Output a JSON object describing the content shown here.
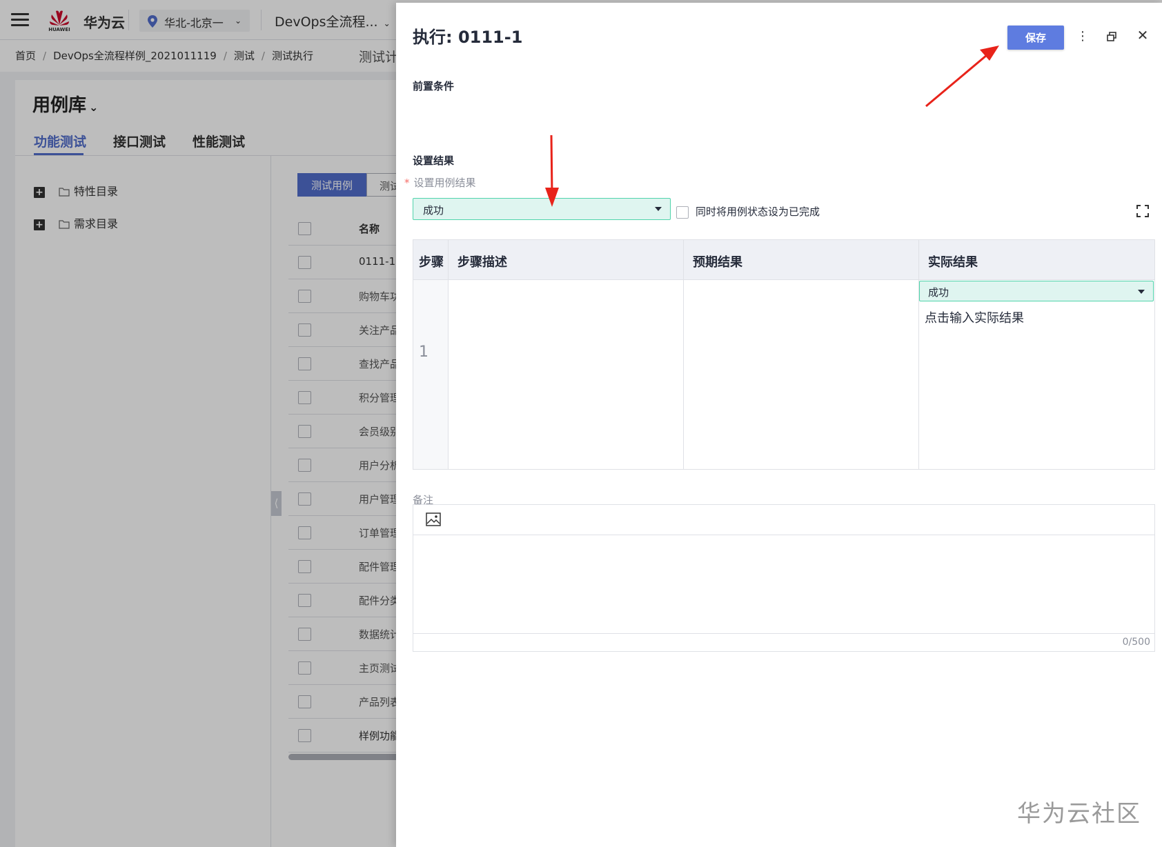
{
  "topbar": {
    "brand": "华为云",
    "logo_text": "HUAWEI",
    "region": "华北-北京一",
    "project": "DevOps全流程..."
  },
  "breadcrumb": {
    "items": [
      "首页",
      "DevOps全流程样例_2021011119",
      "测试",
      "测试执行"
    ],
    "separator": "/",
    "right_text": "测试计"
  },
  "library": {
    "title": "用例库",
    "tabs": [
      {
        "label": "功能测试",
        "active": true
      },
      {
        "label": "接口测试",
        "active": false
      },
      {
        "label": "性能测试",
        "active": false
      }
    ],
    "tree": [
      {
        "label": "特性目录"
      },
      {
        "label": "需求目录"
      }
    ],
    "segments": [
      "测试用例",
      "测试"
    ],
    "table_header": "名称",
    "rows": [
      "0111-1",
      "购物车功",
      "关注产品",
      "查找产品",
      "积分管理",
      "会员级别",
      "用户分析",
      "用户管理",
      "订单管理",
      "配件管理",
      "配件分类",
      "数据统计",
      "主页测试",
      "产品列表",
      "样例功能"
    ]
  },
  "drawer": {
    "title": "执行: 0111-1",
    "save_label": "保存",
    "more_icon": "more-vertical-icon",
    "restore_icon": "window-restore-icon",
    "close_icon": "close-icon",
    "precondition_label": "前置条件",
    "set_result_label": "设置结果",
    "required_label": "设置用例结果",
    "result_value": "成功",
    "mark_complete_label": "同时将用例状态设为已完成",
    "steps": {
      "headers": [
        "步骤",
        "步骤描述",
        "预期结果",
        "实际结果"
      ],
      "rows": [
        {
          "index": "1",
          "description": "",
          "expected": "",
          "actual_status": "成功",
          "actual_placeholder": "点击输入实际结果"
        }
      ]
    },
    "remark_label": "备注",
    "remark_count": "0/500"
  },
  "watermark": "华为云社区",
  "colors": {
    "primary": "#5e7ce0",
    "tab_active": "#526ecc",
    "select_bg": "#dff5f0",
    "select_border": "#50d4ab",
    "annotation_arrow": "#e8231a"
  }
}
